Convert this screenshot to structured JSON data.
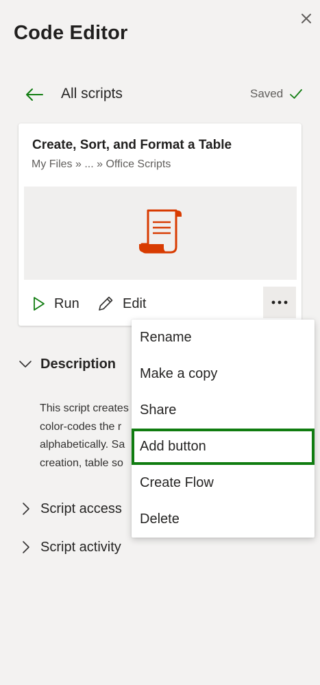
{
  "pane": {
    "title": "Code Editor",
    "close_icon": "close-icon"
  },
  "nav": {
    "back_icon": "arrow-left-icon",
    "all_scripts_label": "All scripts",
    "saved_label": "Saved",
    "saved_icon": "checkmark-icon"
  },
  "script_card": {
    "name": "Create, Sort, and Format a Table",
    "breadcrumb": "My Files » ... » Office Scripts",
    "preview_icon": "script-scroll-icon",
    "run_label": "Run",
    "edit_label": "Edit",
    "more_icon": "more-options-icon"
  },
  "sections": {
    "description": {
      "label": "Description",
      "expanded": true
    },
    "description_lines": [
      "This script creates",
      "color-codes the r",
      "alphabetically. Sa",
      "creation, table so"
    ],
    "script_access": {
      "label": "Script access"
    },
    "script_activity": {
      "label": "Script activity"
    }
  },
  "context_menu": {
    "items": [
      {
        "label": "Rename"
      },
      {
        "label": "Make a copy"
      },
      {
        "label": "Share"
      },
      {
        "label": "Add button",
        "highlighted": true
      },
      {
        "label": "Create Flow"
      },
      {
        "label": "Delete"
      }
    ]
  },
  "colors": {
    "accent_green": "#107c10",
    "script_icon_orange": "#d83b01",
    "background": "#f3f2f1"
  }
}
